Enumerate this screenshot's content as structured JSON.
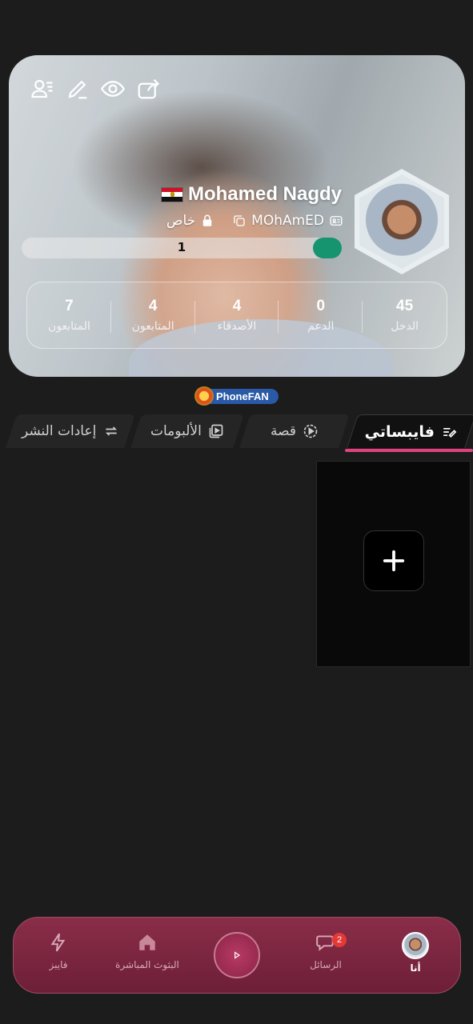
{
  "profile": {
    "name": "Mohamed Nagdy",
    "username": "MOhAmED",
    "privacy": "خاص",
    "level": "1",
    "level_progress": 0.08
  },
  "stats": [
    {
      "value": "45",
      "label": "الدخل"
    },
    {
      "value": "0",
      "label": "الدعم"
    },
    {
      "value": "4",
      "label": "الأصدقاء"
    },
    {
      "value": "4",
      "label": "المتابعون"
    },
    {
      "value": "7",
      "label": "المتابعون"
    }
  ],
  "badge": {
    "label": "PhoneFAN"
  },
  "tabs": [
    {
      "label": "فايبساتي",
      "icon": "feed-edit-icon",
      "active": true
    },
    {
      "label": "قصة",
      "icon": "play-circle-icon"
    },
    {
      "label": "الألبومات",
      "icon": "album-icon"
    },
    {
      "label": "إعادات النشر",
      "icon": "repost-icon"
    }
  ],
  "nav": {
    "me": "أنا",
    "messages": "الرسائل",
    "messages_badge": "2",
    "live": "البثوث المباشرة",
    "vibes": "فايبز"
  },
  "colors": {
    "accent": "#e1427e",
    "nav_bg": "#7a2640",
    "progress": "#15946f",
    "badge_bg": "#2a59a8"
  }
}
